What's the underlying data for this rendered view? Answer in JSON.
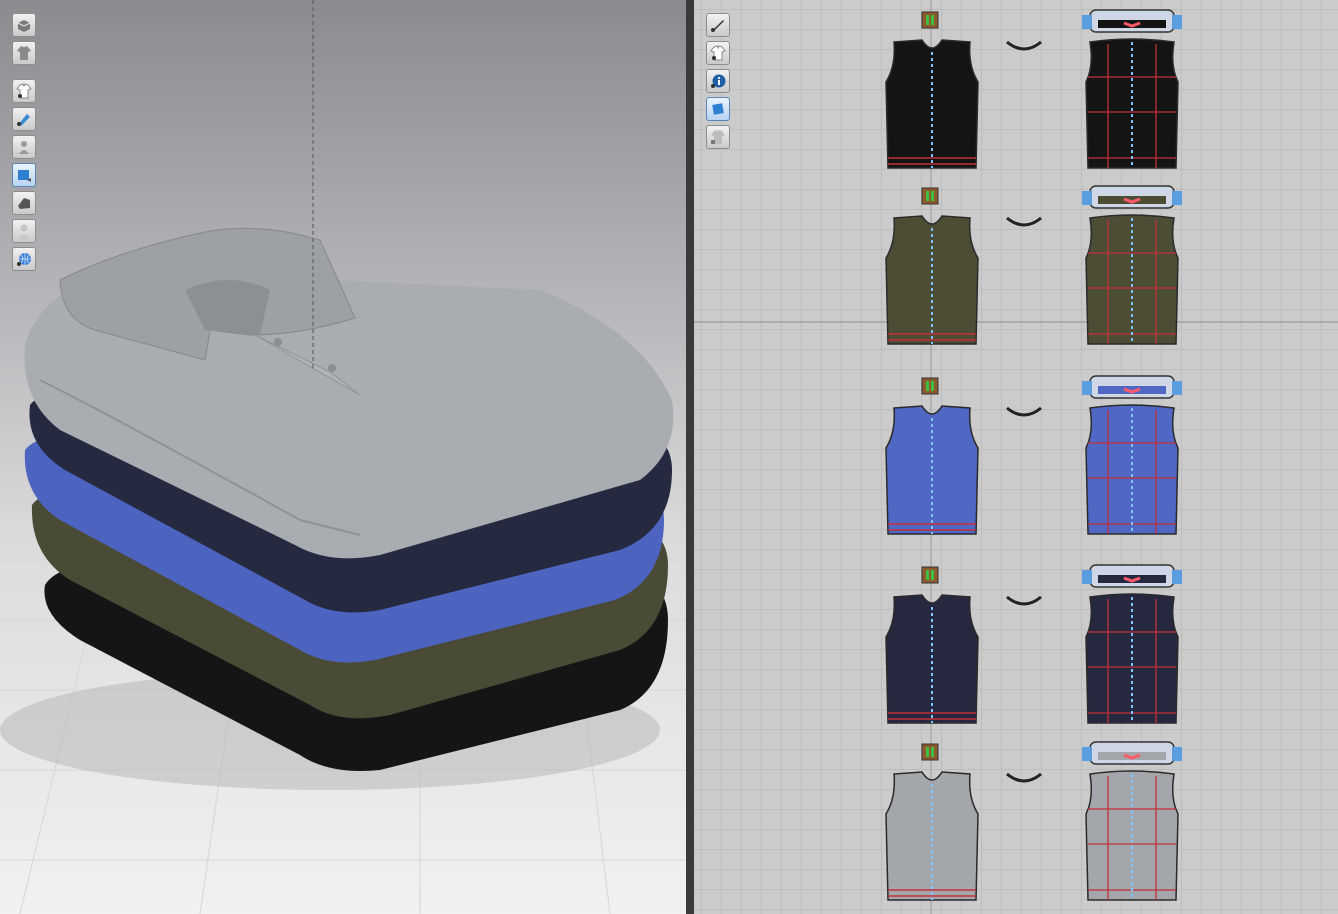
{
  "app": {
    "panels": [
      "3d-view",
      "2d-pattern-view"
    ]
  },
  "toolbar_3d": {
    "buttons": [
      {
        "icon": "cube-display-icon"
      },
      {
        "icon": "garment-display-icon"
      },
      {
        "icon": "show-garment-icon"
      },
      {
        "icon": "show-texture-icon"
      },
      {
        "icon": "show-avatar-icon"
      },
      {
        "icon": "show-arrangement-icon"
      },
      {
        "icon": "show-surface-icon"
      },
      {
        "icon": "avatar-silhouette-icon"
      },
      {
        "icon": "globe-render-icon"
      }
    ]
  },
  "toolbar_2d": {
    "buttons": [
      {
        "icon": "pen-visibility-icon"
      },
      {
        "icon": "shirt-visibility-icon"
      },
      {
        "icon": "info-visibility-icon"
      },
      {
        "icon": "texture-visibility-icon"
      },
      {
        "icon": "lock-shirt-icon"
      }
    ]
  },
  "colors": {
    "shirt_gray": "#a3a7ab",
    "shirt_navy": "#262b42",
    "shirt_blue": "#4f66c3",
    "shirt_olive": "#4a4b35",
    "shirt_black": "#131313",
    "seam_red": "#c0303a",
    "grid_bg": "#cbcbcb"
  },
  "pattern_rows": [
    {
      "name": "black-shirt-pattern",
      "color": "#141414"
    },
    {
      "name": "olive-shirt-pattern",
      "color": "#4d4d35"
    },
    {
      "name": "blue-shirt-pattern",
      "color": "#5167c4"
    },
    {
      "name": "navy-shirt-pattern",
      "color": "#25283e"
    },
    {
      "name": "gray-shirt-pattern",
      "color": "#a3a6aa"
    }
  ]
}
